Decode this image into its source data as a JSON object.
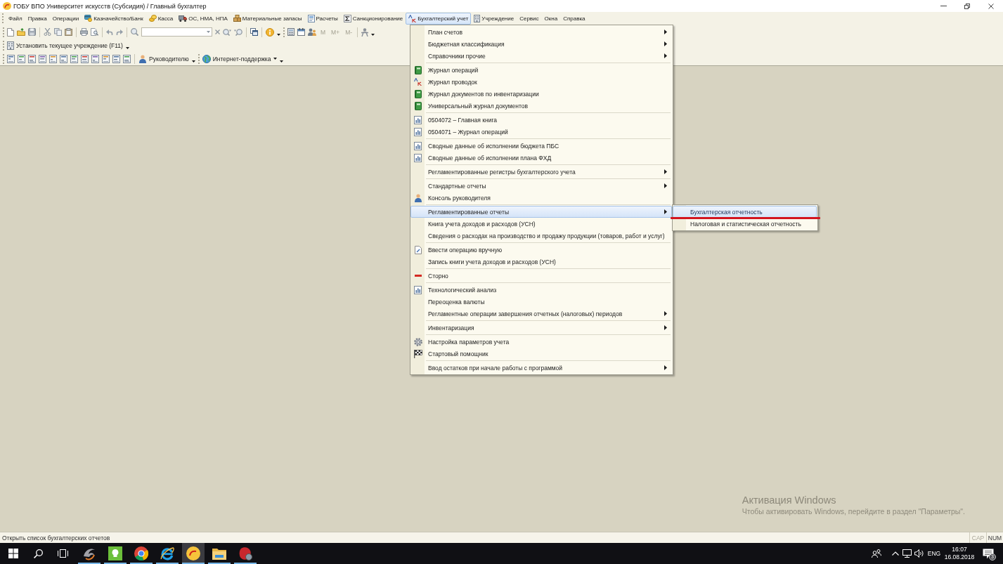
{
  "window": {
    "title": "ГОБУ ВПО Университет искусств (Субсидия) / Главный бухгалтер"
  },
  "menu_bar": {
    "items": [
      {
        "label": "Файл",
        "kind": "plain",
        "selected": false
      },
      {
        "label": "Правка",
        "kind": "plain",
        "selected": false
      },
      {
        "label": "Операции",
        "kind": "plain",
        "selected": false
      },
      {
        "label": "Казначейство/Банк",
        "kind": "treasury",
        "selected": false
      },
      {
        "label": "Касса",
        "kind": "cash",
        "selected": false
      },
      {
        "label": "ОС, НМА, НПА",
        "kind": "assets",
        "selected": false
      },
      {
        "label": "Материальные запасы",
        "kind": "stock",
        "selected": false
      },
      {
        "label": "Расчеты",
        "kind": "settlements",
        "selected": false
      },
      {
        "label": "Санкционирование",
        "kind": "sanction",
        "selected": false
      },
      {
        "label": "Бухгалтерский учет",
        "kind": "ledger",
        "selected": true
      },
      {
        "label": "Учреждение",
        "kind": "institution",
        "selected": false
      },
      {
        "label": "Сервис",
        "kind": "plain",
        "selected": false
      },
      {
        "label": "Окна",
        "kind": "plain",
        "selected": false
      },
      {
        "label": "Справка",
        "kind": "plain",
        "selected": false
      }
    ]
  },
  "toolbars": {
    "memory_buttons": [
      {
        "label": "M",
        "disabled": true
      },
      {
        "label": "M+",
        "disabled": true
      },
      {
        "label": "M-",
        "disabled": true
      }
    ],
    "institution_button": {
      "label": "Установить текущее учреждение (F11)"
    },
    "manager_button": {
      "label": "Руководителю"
    },
    "support_button": {
      "label": "Интернет-поддержка"
    }
  },
  "dropdown_menu": {
    "groups": [
      {
        "items": [
          {
            "label": "План счетов",
            "kind": "plain",
            "has_submenu": true,
            "selected": false
          },
          {
            "label": "Бюджетная классификация",
            "kind": "plain",
            "has_submenu": true,
            "selected": false
          },
          {
            "label": "Справочники прочие",
            "kind": "plain",
            "has_submenu": true,
            "selected": false
          }
        ]
      },
      {
        "items": [
          {
            "label": "Журнал операций",
            "kind": "journal",
            "has_submenu": false,
            "selected": false
          },
          {
            "label": "Журнал проводок",
            "kind": "entries",
            "has_submenu": false,
            "selected": false
          },
          {
            "label": "Журнал документов по инвентаризации",
            "kind": "journal",
            "has_submenu": false,
            "selected": false
          },
          {
            "label": "Универсальный журнал документов",
            "kind": "journal",
            "has_submenu": false,
            "selected": false
          }
        ]
      },
      {
        "items": [
          {
            "label": "0504072 – Главная книга",
            "kind": "report",
            "has_submenu": false,
            "selected": false
          },
          {
            "label": "0504071 – Журнал операций",
            "kind": "report",
            "has_submenu": false,
            "selected": false
          }
        ]
      },
      {
        "items": [
          {
            "label": "Сводные данные об исполнении бюджета ПБС",
            "kind": "report",
            "has_submenu": false,
            "selected": false
          },
          {
            "label": "Сводные данные об исполнении плана ФХД",
            "kind": "report",
            "has_submenu": false,
            "selected": false
          }
        ]
      },
      {
        "items": [
          {
            "label": "Регламентированные регистры бухгалтерского учета",
            "kind": "plain",
            "has_submenu": true,
            "selected": false
          }
        ]
      },
      {
        "items": [
          {
            "label": "Стандартные отчеты",
            "kind": "plain",
            "has_submenu": true,
            "selected": false
          },
          {
            "label": "Консоль руководителя",
            "kind": "console",
            "has_submenu": false,
            "selected": false
          }
        ]
      },
      {
        "items": [
          {
            "label": "Регламентированные отчеты",
            "kind": "plain",
            "has_submenu": true,
            "selected": true
          },
          {
            "label": "Книга учета доходов и расходов (УСН)",
            "kind": "plain",
            "has_submenu": false,
            "selected": false
          },
          {
            "label": "Сведения о расходах на производство и продажу продукции (товаров, работ и услуг)",
            "kind": "plain",
            "has_submenu": false,
            "selected": false
          }
        ]
      },
      {
        "items": [
          {
            "label": "Ввести операцию вручную",
            "kind": "manual",
            "has_submenu": false,
            "selected": false
          },
          {
            "label": "Запись книги учета доходов и расходов (УСН)",
            "kind": "plain",
            "has_submenu": false,
            "selected": false
          }
        ]
      },
      {
        "items": [
          {
            "label": "Сторно",
            "kind": "storno",
            "has_submenu": false,
            "selected": false
          }
        ]
      },
      {
        "items": [
          {
            "label": "Технологический анализ",
            "kind": "report",
            "has_submenu": false,
            "selected": false
          },
          {
            "label": "Переоценка валюты",
            "kind": "plain",
            "has_submenu": false,
            "selected": false
          },
          {
            "label": "Регламентные операции завершения отчетных (налоговых) периодов",
            "kind": "plain",
            "has_submenu": true,
            "selected": false
          }
        ]
      },
      {
        "items": [
          {
            "label": "Инвентаризация",
            "kind": "plain",
            "has_submenu": true,
            "selected": false
          }
        ]
      },
      {
        "items": [
          {
            "label": "Настройка параметров учета",
            "kind": "settings",
            "has_submenu": false,
            "selected": false
          },
          {
            "label": "Стартовый помощник",
            "kind": "wizard",
            "has_submenu": false,
            "selected": false
          }
        ]
      },
      {
        "items": [
          {
            "label": "Ввод остатков при начале работы с программой",
            "kind": "plain",
            "has_submenu": true,
            "selected": false
          }
        ]
      }
    ]
  },
  "submenu": {
    "items": [
      {
        "label": "Бухгалтерская отчетность",
        "selected": true,
        "underlined": true
      },
      {
        "label": "Налоговая и статистическая отчетность",
        "selected": false,
        "underlined": false
      }
    ]
  },
  "activation_notice": {
    "title": "Активация Windows",
    "text": "Чтобы активировать Windows, перейдите в раздел \"Параметры\"."
  },
  "status_bar": {
    "text": "Открыть список бухгалтерских отчетов",
    "indicators": [
      {
        "label": "CAP",
        "on": false
      },
      {
        "label": "NUM",
        "on": true
      }
    ]
  },
  "taskbar": {
    "apps": [
      {
        "running": true,
        "selected": false
      },
      {
        "running": true,
        "selected": false
      },
      {
        "running": true,
        "selected": false
      },
      {
        "running": true,
        "selected": false
      },
      {
        "running": true,
        "selected": true
      },
      {
        "running": true,
        "selected": false
      },
      {
        "running": true,
        "selected": false
      }
    ],
    "tray": {
      "language": "ENG",
      "time": "16:07",
      "date": "16.08.2018",
      "notification_count": "3"
    }
  }
}
